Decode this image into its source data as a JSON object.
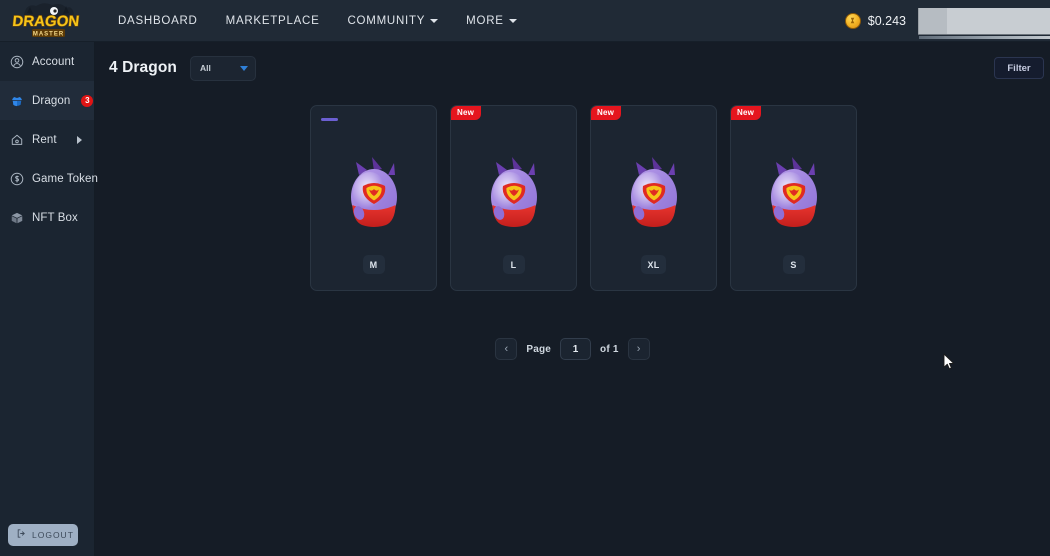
{
  "app": {
    "logo_text_primary": "DRAGON",
    "logo_text_secondary": "MASTER"
  },
  "topnav": {
    "links": [
      {
        "label": "DASHBOARD",
        "has_caret": false
      },
      {
        "label": "MARKETPLACE",
        "has_caret": false
      },
      {
        "label": "COMMUNITY",
        "has_caret": true
      },
      {
        "label": "MORE",
        "has_caret": true
      }
    ],
    "coin": {
      "icon": "coin-icon",
      "price": "$0.243"
    }
  },
  "sidebar": {
    "items": [
      {
        "label": "Account",
        "icon": "user-circle-icon",
        "badge": "",
        "arrow": false,
        "active": false
      },
      {
        "label": "Dragon",
        "icon": "dragon-icon",
        "badge": "3",
        "arrow": false,
        "active": true
      },
      {
        "label": "Rent",
        "icon": "home-lock-icon",
        "badge": "",
        "arrow": true,
        "active": false
      },
      {
        "label": "Game Token",
        "icon": "dollar-circle-icon",
        "badge": "",
        "arrow": false,
        "active": false
      },
      {
        "label": "NFT Box",
        "icon": "box-icon",
        "badge": "",
        "arrow": false,
        "active": false
      }
    ],
    "logout": {
      "label": "LOGOUT",
      "icon": "logout-icon"
    }
  },
  "main": {
    "page_title": "4 Dragon",
    "filter_select": {
      "value": "All",
      "options": [
        "All"
      ]
    },
    "filter_button": {
      "label": "Filter"
    },
    "cards": [
      {
        "size": "M",
        "badge": "",
        "badge_type": "dash"
      },
      {
        "size": "L",
        "badge": "New",
        "badge_type": "new"
      },
      {
        "size": "XL",
        "badge": "New",
        "badge_type": "new"
      },
      {
        "size": "S",
        "badge": "New",
        "badge_type": "new"
      }
    ],
    "pagination": {
      "prev": "‹",
      "next": "›",
      "page_label": "Page",
      "page_value": "1",
      "of_label": "of 1"
    }
  },
  "colors": {
    "accent_blue": "#2f7fd6",
    "badge_red": "#e5151e",
    "sidebar_badge_red": "#e01414",
    "gold": "#f6b829",
    "purple": "#6b5fd1",
    "nav_bg": "#202a36",
    "sidebar_bg": "#1b2531",
    "main_bg": "#151c26",
    "card_bg": "#1c2531"
  }
}
